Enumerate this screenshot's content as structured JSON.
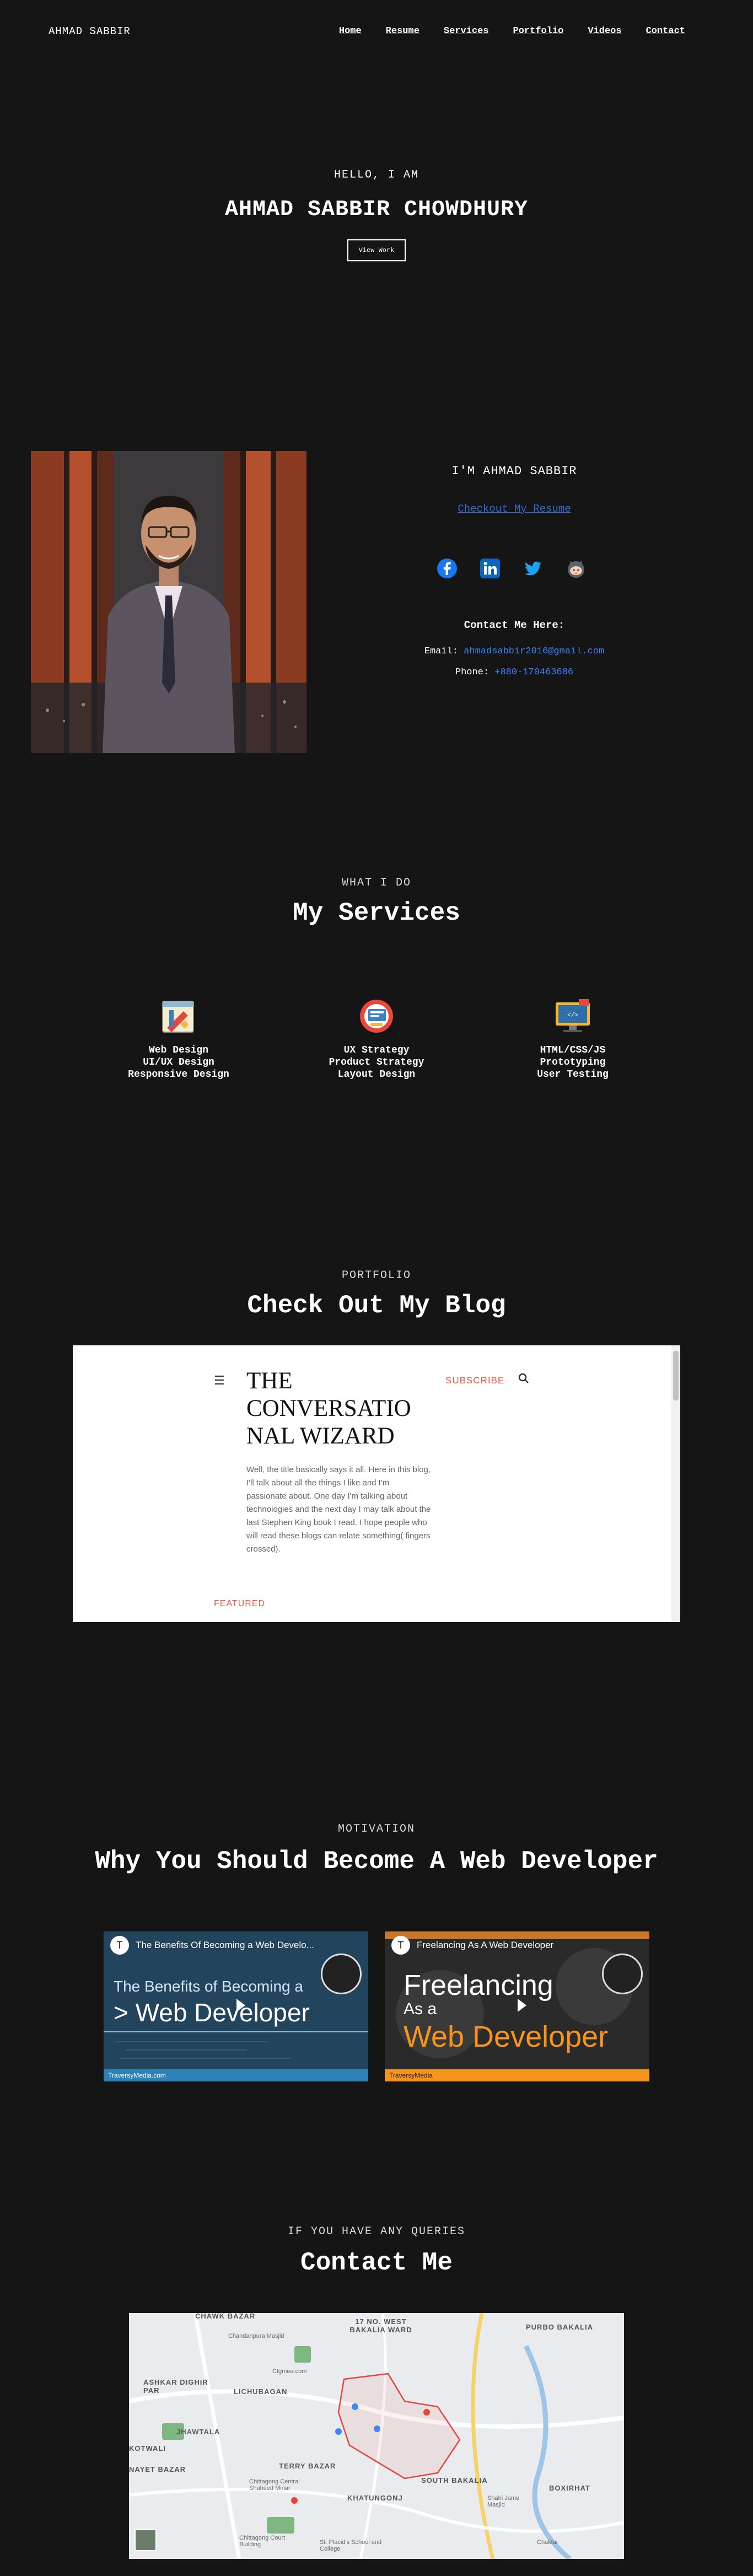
{
  "nav": {
    "brand": "AHMAD SABBIR",
    "items": [
      "Home",
      "Resume",
      "Services",
      "Portfolio",
      "Videos",
      "Contact"
    ]
  },
  "hero": {
    "greeting": "HELLO, I AM",
    "name": "AHMAD SABBIR CHOWDHURY",
    "button": "View Work"
  },
  "about": {
    "heading": "I'M AHMAD SABBIR",
    "resume_link": "Checkout My Resume",
    "social_icons": [
      "facebook-icon",
      "linkedin-icon",
      "twitter-icon",
      "github-icon"
    ],
    "contact_heading": "Contact Me Here:",
    "email_label": "Email:",
    "email_value": "ahmadsabbir2016@gmail.com",
    "phone_label": "Phone:",
    "phone_value": "+880-170463686"
  },
  "services": {
    "subtitle": "WHAT I DO",
    "title": "My Services",
    "items": [
      {
        "icon": "design-tools-icon",
        "lines": [
          "Web Design",
          "UI/UX Design",
          "Responsive Design"
        ]
      },
      {
        "icon": "strategy-icon",
        "lines": [
          "UX Strategy",
          "Product Strategy",
          "Layout Design"
        ]
      },
      {
        "icon": "code-monitor-icon",
        "lines": [
          "HTML/CSS/JS",
          "Prototyping",
          "User Testing"
        ]
      }
    ]
  },
  "portfolio": {
    "subtitle": "PORTFOLIO",
    "title": "Check Out My Blog",
    "blog": {
      "title": "THE CONVERSATIO NAL WIZARD",
      "subscribe": "SUBSCRIBE",
      "description": "Well, the title basically says it all. Here in this blog, I'll talk about all the things I like and I'm passionate about. One day I'm talking about technologies and the next day I may talk about the last Stephen King book I read. I hope people who will read these blogs can relate something( fingers crossed).",
      "featured": "FEATURED"
    }
  },
  "motivation": {
    "subtitle": "MOTIVATION",
    "title": "Why You Should Become A Web Developer",
    "videos": [
      {
        "title": "The Benefits Of Becoming a Web Develo...",
        "line1": "The Benefits of Becoming a",
        "line2": "> Web Developer",
        "footer": "TraversyMedia.com",
        "avatar": "T",
        "accent": "#2aa1dc"
      },
      {
        "title": "Freelancing As A Web Developer",
        "line1": "Freelancing",
        "line2": "As a",
        "line3": "Web Developer",
        "footer": "TraversyMedia",
        "avatar": "T",
        "accent": "#f7941d"
      }
    ]
  },
  "contact": {
    "subtitle": "IF YOU HAVE ANY QUERIES",
    "title": "Contact Me",
    "map_labels": [
      "CHAWK BAZAR",
      "17 NO. WEST BAKALIA WARD",
      "PURBO BAKALIA",
      "Chandanpura Masjid",
      "Ctgmea.com",
      "ASHKAR DIGHIR PAR",
      "LICHUBAGAN",
      "JHAWTALA",
      "KOTWALI",
      "NAYET BAZAR",
      "TERRY BAZAR",
      "SOUTH BAKALIA",
      "KHATUNGONJ",
      "BOXIRHAT",
      "Chittagong Central Shaheed Minar",
      "Chittagong Court Building",
      "St. Placid's School and College",
      "Chaktai",
      "Shahi Jame Masjid"
    ]
  }
}
